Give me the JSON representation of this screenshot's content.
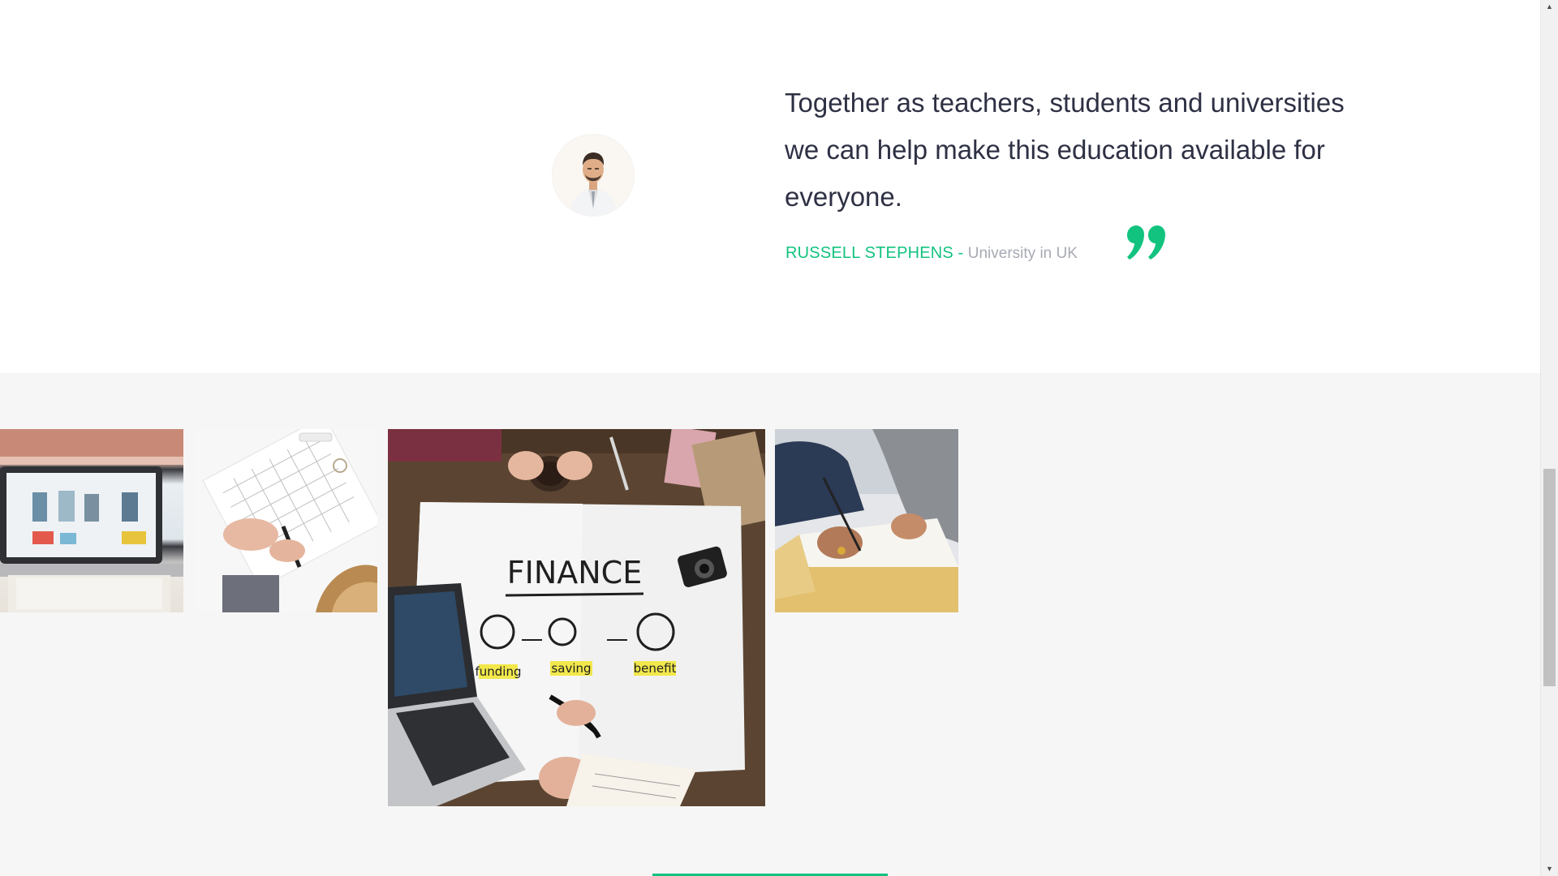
{
  "testimonial": {
    "quote": "Together as teachers, students and universities we can help make this education available for everyone.",
    "author_name": "RUSSELL STEPHENS",
    "separator": " - ",
    "author_role": "University in UK",
    "quote_icon": "closing-quote-icon",
    "accent_color": "#12c37f"
  },
  "gallery": {
    "images": [
      {
        "name": "laptop-shopping-photo"
      },
      {
        "name": "notebook-planner-photo"
      },
      {
        "name": "finance-planning-photo",
        "caption_words": [
          "FINANCE",
          "funding",
          "saving",
          "benefit"
        ]
      },
      {
        "name": "document-signing-photo"
      }
    ]
  },
  "scrollbar": {
    "up_icon": "scroll-up-arrow-icon",
    "down_icon": "scroll-down-arrow-icon"
  }
}
